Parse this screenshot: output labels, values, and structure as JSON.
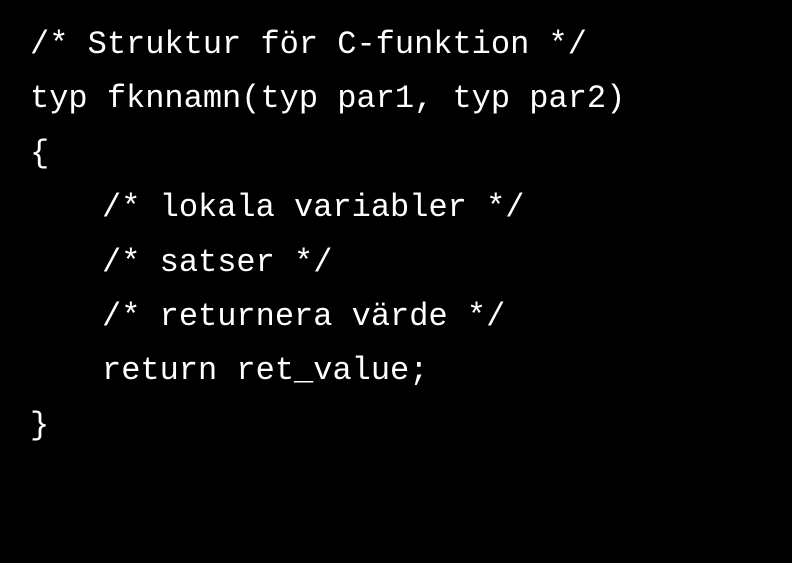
{
  "code": {
    "line1": "/* Struktur för C-funktion */",
    "line2": "",
    "line3": "typ fknnamn(typ par1, typ par2)",
    "line4": "{",
    "line5": "/* lokala variabler */",
    "line6": "/* satser */",
    "line7": "/* returnera värde */",
    "line8": "return ret_value;",
    "line9": "}"
  }
}
